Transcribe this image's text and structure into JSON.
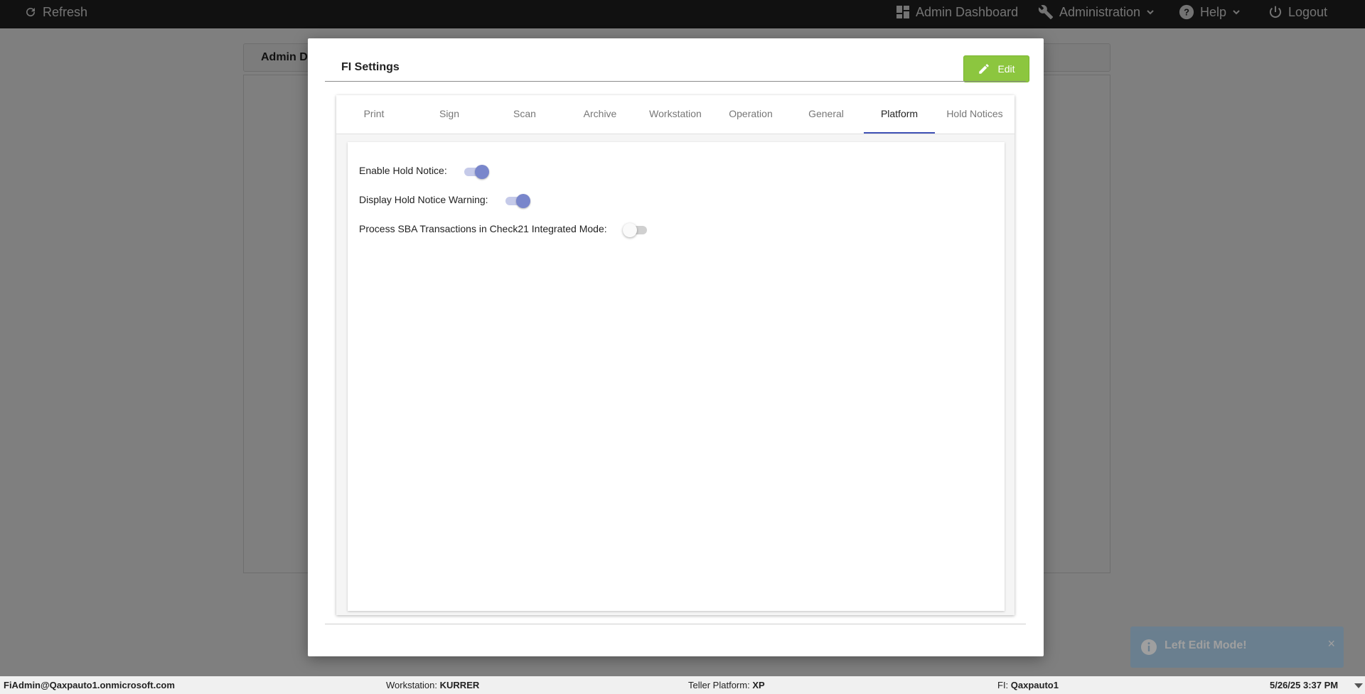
{
  "topbar": {
    "refresh_label": "Refresh",
    "admin_dashboard_label": "Admin Dashboard",
    "administration_label": "Administration",
    "help_label": "Help",
    "logout_label": "Logout"
  },
  "background_page": {
    "card_title": "Admin D"
  },
  "modal": {
    "title": "FI Settings",
    "edit_label": "Edit",
    "tabs": [
      {
        "label": "Print"
      },
      {
        "label": "Sign"
      },
      {
        "label": "Scan"
      },
      {
        "label": "Archive"
      },
      {
        "label": "Workstation"
      },
      {
        "label": "Operation"
      },
      {
        "label": "General"
      },
      {
        "label": "Platform",
        "active": true
      },
      {
        "label": "Hold Notices"
      }
    ],
    "settings": [
      {
        "label": "Enable Hold Notice:",
        "enabled": true
      },
      {
        "label": "Display Hold Notice Warning:",
        "enabled": true
      },
      {
        "label": "Process SBA Transactions in Check21 Integrated Mode:",
        "enabled": false
      }
    ]
  },
  "toast": {
    "message": "Left Edit Mode!",
    "close": "×"
  },
  "statusbar": {
    "user": "FiAdmin@Qaxpauto1.onmicrosoft.com",
    "workstation_label": "Workstation:",
    "workstation_value": "KURRER",
    "teller_label": "Teller Platform:",
    "teller_value": "XP",
    "fi_label": "FI:",
    "fi_value": "Qaxpauto1",
    "datetime": "5/26/25 3:37 PM"
  },
  "colors": {
    "topbar": "#222222",
    "edit_button": "#8cc63f",
    "active_tab_indicator": "#3f51b5",
    "toggle_on": "#7986cb",
    "toast": "#2f80c0"
  }
}
